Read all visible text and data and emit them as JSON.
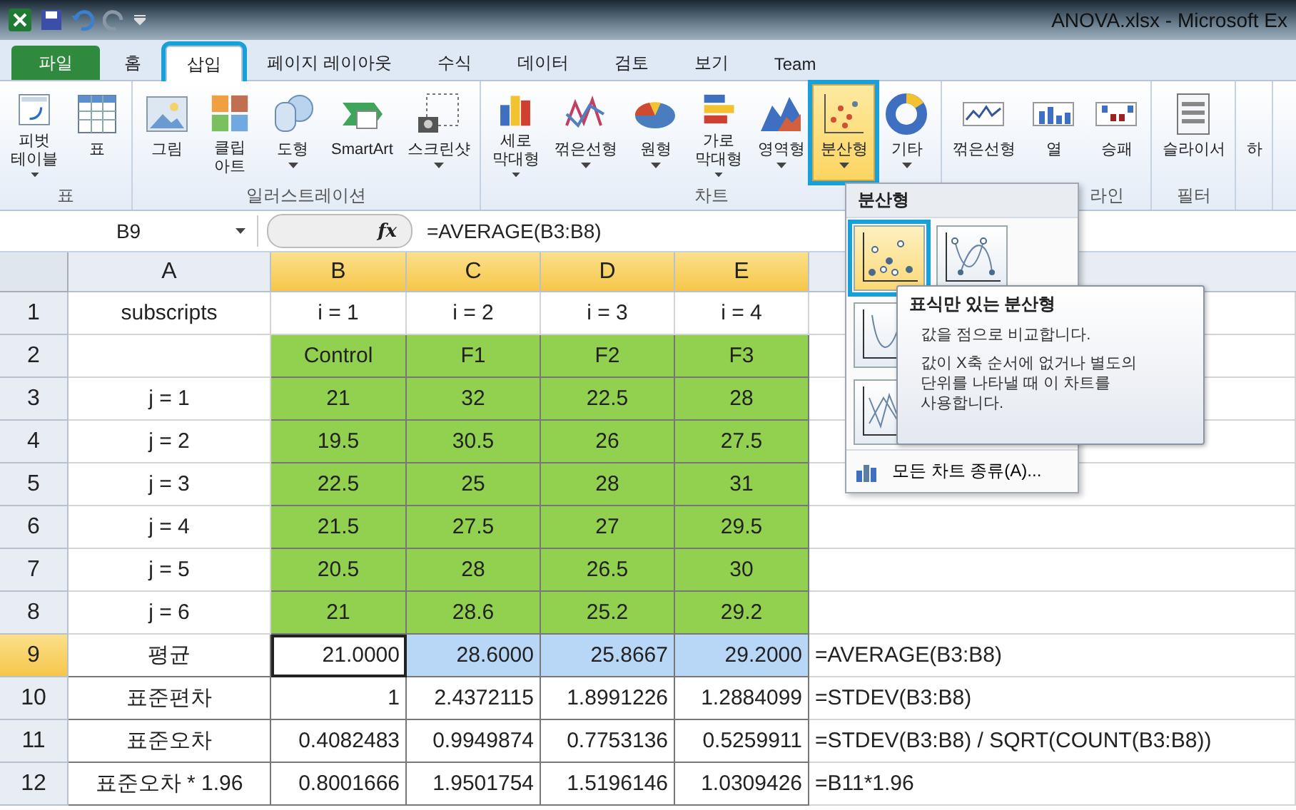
{
  "window": {
    "title": "ANOVA.xlsx  -  Microsoft Ex"
  },
  "tabs": [
    {
      "label": "파일",
      "kind": "file",
      "selected": false,
      "highlighted": false
    },
    {
      "label": "홈",
      "kind": "tab",
      "selected": false,
      "highlighted": false
    },
    {
      "label": "삽입",
      "kind": "tab",
      "selected": true,
      "highlighted": true
    },
    {
      "label": "페이지 레이아웃",
      "kind": "tab",
      "selected": false,
      "highlighted": false
    },
    {
      "label": "수식",
      "kind": "tab",
      "selected": false,
      "highlighted": false
    },
    {
      "label": "데이터",
      "kind": "tab",
      "selected": false,
      "highlighted": false
    },
    {
      "label": "검토",
      "kind": "tab",
      "selected": false,
      "highlighted": false
    },
    {
      "label": "보기",
      "kind": "tab",
      "selected": false,
      "highlighted": false
    },
    {
      "label": "Team",
      "kind": "tab",
      "selected": false,
      "highlighted": false
    }
  ],
  "ribbon_groups": [
    {
      "label": "표",
      "buttons": [
        {
          "label": "피벗\n테이블",
          "kind": "pivot",
          "has_menu": true,
          "highlighted": false
        },
        {
          "label": "표",
          "kind": "table",
          "has_menu": false,
          "highlighted": false
        }
      ]
    },
    {
      "label": "일러스트레이션",
      "buttons": [
        {
          "label": "그림",
          "kind": "picture",
          "has_menu": false,
          "highlighted": false
        },
        {
          "label": "클립\n아트",
          "kind": "clipart",
          "has_menu": false,
          "highlighted": false
        },
        {
          "label": "도형",
          "kind": "shapes",
          "has_menu": true,
          "highlighted": false
        },
        {
          "label": "SmartArt",
          "kind": "smartart",
          "has_menu": false,
          "highlighted": false
        },
        {
          "label": "스크린샷",
          "kind": "screenshot",
          "has_menu": true,
          "highlighted": false
        }
      ]
    },
    {
      "label": "차트",
      "buttons": [
        {
          "label": "세로\n막대형",
          "kind": "column",
          "has_menu": true,
          "highlighted": false
        },
        {
          "label": "꺾은선형",
          "kind": "line",
          "has_menu": true,
          "highlighted": false
        },
        {
          "label": "원형",
          "kind": "pie",
          "has_menu": true,
          "highlighted": false
        },
        {
          "label": "가로\n막대형",
          "kind": "bar",
          "has_menu": true,
          "highlighted": false
        },
        {
          "label": "영역형",
          "kind": "area",
          "has_menu": true,
          "highlighted": false
        },
        {
          "label": "분산형",
          "kind": "scatter",
          "has_menu": true,
          "highlighted": true
        },
        {
          "label": "기타",
          "kind": "donut",
          "has_menu": true,
          "highlighted": false
        }
      ]
    },
    {
      "label": "라인",
      "buttons": [
        {
          "label": "꺾은선형",
          "kind": "sparkline",
          "has_menu": false,
          "highlighted": false
        },
        {
          "label": "열",
          "kind": "sparkcolumn",
          "has_menu": false,
          "highlighted": false
        },
        {
          "label": "승패",
          "kind": "winloss",
          "has_menu": false,
          "highlighted": false
        }
      ]
    },
    {
      "label": "필터",
      "buttons": [
        {
          "label": "슬라이서",
          "kind": "slicer",
          "has_menu": false,
          "highlighted": false
        }
      ]
    },
    {
      "buttons": [
        {
          "label": "하",
          "kind": "cut",
          "has_menu": false,
          "highlighted": false
        }
      ]
    }
  ],
  "formula_bar": {
    "name_box": "B9",
    "function_label": "fx",
    "formula": "=AVERAGE(B3:B8)"
  },
  "columns": [
    {
      "label": "A",
      "selected": false
    },
    {
      "label": "B",
      "selected": true
    },
    {
      "label": "C",
      "selected": true
    },
    {
      "label": "D",
      "selected": true
    },
    {
      "label": "E",
      "selected": true
    }
  ],
  "rows": [
    {
      "header": "1",
      "selected": false,
      "kind": "text",
      "cells": [
        {
          "text": "subscripts"
        },
        {
          "text": "i = 1"
        },
        {
          "text": "i = 2"
        },
        {
          "text": "i = 3"
        },
        {
          "text": "i = 4"
        }
      ]
    },
    {
      "header": "2",
      "selected": false,
      "kind": "text",
      "cells": [
        {
          "text": ""
        },
        {
          "text": "Control",
          "color": "#92d050"
        },
        {
          "text": "F1",
          "color": "#92d050"
        },
        {
          "text": "F2",
          "color": "#92d050"
        },
        {
          "text": "F3",
          "color": "#92d050"
        }
      ]
    },
    {
      "header": "3",
      "selected": false,
      "kind": "text",
      "cells": [
        {
          "text": "j = 1"
        },
        {
          "text": "21",
          "color": "#92d050"
        },
        {
          "text": "32",
          "color": "#92d050"
        },
        {
          "text": "22.5",
          "color": "#92d050"
        },
        {
          "text": "28",
          "color": "#92d050"
        }
      ]
    },
    {
      "header": "4",
      "selected": false,
      "kind": "text",
      "cells": [
        {
          "text": "j = 2"
        },
        {
          "text": "19.5",
          "color": "#92d050"
        },
        {
          "text": "30.5",
          "color": "#92d050"
        },
        {
          "text": "26",
          "color": "#92d050"
        },
        {
          "text": "27.5",
          "color": "#92d050"
        }
      ]
    },
    {
      "header": "5",
      "selected": false,
      "kind": "text",
      "cells": [
        {
          "text": "j = 3"
        },
        {
          "text": "22.5",
          "color": "#92d050"
        },
        {
          "text": "25",
          "color": "#92d050"
        },
        {
          "text": "28",
          "color": "#92d050"
        },
        {
          "text": "31",
          "color": "#92d050"
        }
      ]
    },
    {
      "header": "6",
      "selected": false,
      "kind": "text",
      "cells": [
        {
          "text": "j = 4"
        },
        {
          "text": "21.5",
          "color": "#92d050"
        },
        {
          "text": "27.5",
          "color": "#92d050"
        },
        {
          "text": "27",
          "color": "#92d050"
        },
        {
          "text": "29.5",
          "color": "#92d050"
        }
      ]
    },
    {
      "header": "7",
      "selected": false,
      "kind": "text",
      "cells": [
        {
          "text": "j = 5"
        },
        {
          "text": "20.5",
          "color": "#92d050"
        },
        {
          "text": "28",
          "color": "#92d050"
        },
        {
          "text": "26.5",
          "color": "#92d050"
        },
        {
          "text": "30",
          "color": "#92d050"
        }
      ]
    },
    {
      "header": "8",
      "selected": false,
      "kind": "text",
      "cells": [
        {
          "text": "j = 6"
        },
        {
          "text": "21",
          "color": "#92d050"
        },
        {
          "text": "28.6",
          "color": "#92d050"
        },
        {
          "text": "25.2",
          "color": "#92d050"
        },
        {
          "text": "29.2",
          "color": "#92d050"
        }
      ]
    },
    {
      "header": "9",
      "selected": true,
      "kind": "number",
      "note": "=AVERAGE(B3:B8)",
      "cells": [
        {
          "text": "평균"
        },
        {
          "text": "21.0000",
          "active": true
        },
        {
          "text": "28.6000",
          "color": "#b8d7f7"
        },
        {
          "text": "25.8667",
          "color": "#b8d7f7"
        },
        {
          "text": "29.2000",
          "color": "#b8d7f7"
        }
      ]
    },
    {
      "header": "10",
      "selected": false,
      "kind": "number",
      "note": "=STDEV(B3:B8)",
      "cells": [
        {
          "text": "표준편차"
        },
        {
          "text": "1"
        },
        {
          "text": "2.4372115"
        },
        {
          "text": "1.8991226"
        },
        {
          "text": "1.2884099"
        }
      ]
    },
    {
      "header": "11",
      "selected": false,
      "kind": "number",
      "note": "=STDEV(B3:B8) / SQRT(COUNT(B3:B8))",
      "cells": [
        {
          "text": "표준오차"
        },
        {
          "text": "0.4082483"
        },
        {
          "text": "0.9949874"
        },
        {
          "text": "0.7753136"
        },
        {
          "text": "0.5259911"
        }
      ]
    },
    {
      "header": "12",
      "selected": false,
      "kind": "number",
      "note": "=B11*1.96",
      "cells": [
        {
          "text": "표준오차 * 1.96"
        },
        {
          "text": "0.8001666"
        },
        {
          "text": "1.9501754"
        },
        {
          "text": "1.5196146"
        },
        {
          "text": "1.0309426"
        }
      ]
    }
  ],
  "dropdown": {
    "heading": "분산형",
    "options": [
      [
        {
          "kind": "markers",
          "highlighted": true
        },
        {
          "kind": "smooth-markers",
          "highlighted": false
        }
      ],
      [
        {
          "kind": "smooth",
          "highlighted": false
        }
      ],
      [
        {
          "kind": "straight",
          "highlighted": false
        }
      ]
    ],
    "footer": "모든 차트 종류(A)..."
  },
  "tooltip": {
    "title": "표식만 있는 분산형",
    "lines": [
      "값을 점으로 비교합니다.",
      "값이 X축 순서에 없거나 별도의\n단위를 나타낼 때 이 차트를\n사용합니다."
    ]
  }
}
